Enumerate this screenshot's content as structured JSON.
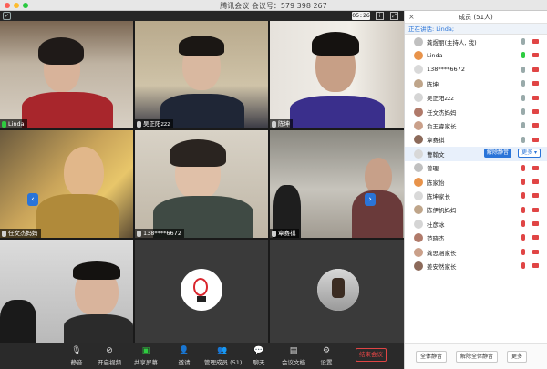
{
  "window": {
    "title": "腾讯会议 会议号：579 398 267"
  },
  "video_bar": {
    "timer": "05:26"
  },
  "tiles": [
    {
      "name": "Linda",
      "mic": "on"
    },
    {
      "name": "吴正阳zzz",
      "mic": "off"
    },
    {
      "name": "陈坤",
      "mic": "off"
    },
    {
      "name": "任文杰妈妈",
      "mic": "off"
    },
    {
      "name": "138****6672",
      "mic": "off"
    },
    {
      "name": "章赛祺",
      "mic": "off"
    },
    {
      "name": "",
      "mic": "off"
    },
    {
      "name": "",
      "mic": "off"
    },
    {
      "name": "",
      "mic": "off"
    }
  ],
  "toolbar": {
    "mute": "静音",
    "video": "开启视频",
    "share": "共享屏幕",
    "invite": "邀请",
    "manage": "管理成员 (51)",
    "chat": "聊天",
    "docs": "会议文档",
    "settings": "设置",
    "end": "结束会议"
  },
  "panel": {
    "header": "成员 (51人)",
    "speaking": "正在讲话: Linda;",
    "participants": [
      {
        "name": "龚煜丽(主持人, 我)",
        "mic": "normal",
        "cam": "off"
      },
      {
        "name": "Linda",
        "mic": "on",
        "cam": "off"
      },
      {
        "name": "138****6672",
        "mic": "normal",
        "cam": "off"
      },
      {
        "name": "陈坤",
        "mic": "normal",
        "cam": "off"
      },
      {
        "name": "吴正阳zzz",
        "mic": "normal",
        "cam": "off"
      },
      {
        "name": "任文杰妈妈",
        "mic": "normal",
        "cam": "off"
      },
      {
        "name": "俞王睿家长",
        "mic": "normal",
        "cam": "off"
      },
      {
        "name": "章赛祺",
        "mic": "normal",
        "cam": "off"
      },
      {
        "name": "曹翰文",
        "mic": "normal",
        "cam": "off"
      },
      {
        "name": "曾理",
        "mic": "muted",
        "cam": "off"
      },
      {
        "name": "陈家怡",
        "mic": "muted",
        "cam": "off"
      },
      {
        "name": "陈坤家长",
        "mic": "muted",
        "cam": "off"
      },
      {
        "name": "陈伊帆妈妈",
        "mic": "muted",
        "cam": "off"
      },
      {
        "name": "杜彦冰",
        "mic": "muted",
        "cam": "off"
      },
      {
        "name": "范晓杰",
        "mic": "muted",
        "cam": "off"
      },
      {
        "name": "龚思涵家长",
        "mic": "muted",
        "cam": "off"
      },
      {
        "name": "姜安然家长",
        "mic": "muted",
        "cam": "off"
      }
    ],
    "row_actions": {
      "unmute": "解除静音",
      "more": "更多 ▾"
    },
    "footer": {
      "mute_all": "全体静音",
      "unmute_all": "解除全体静音",
      "more": "更多"
    }
  }
}
